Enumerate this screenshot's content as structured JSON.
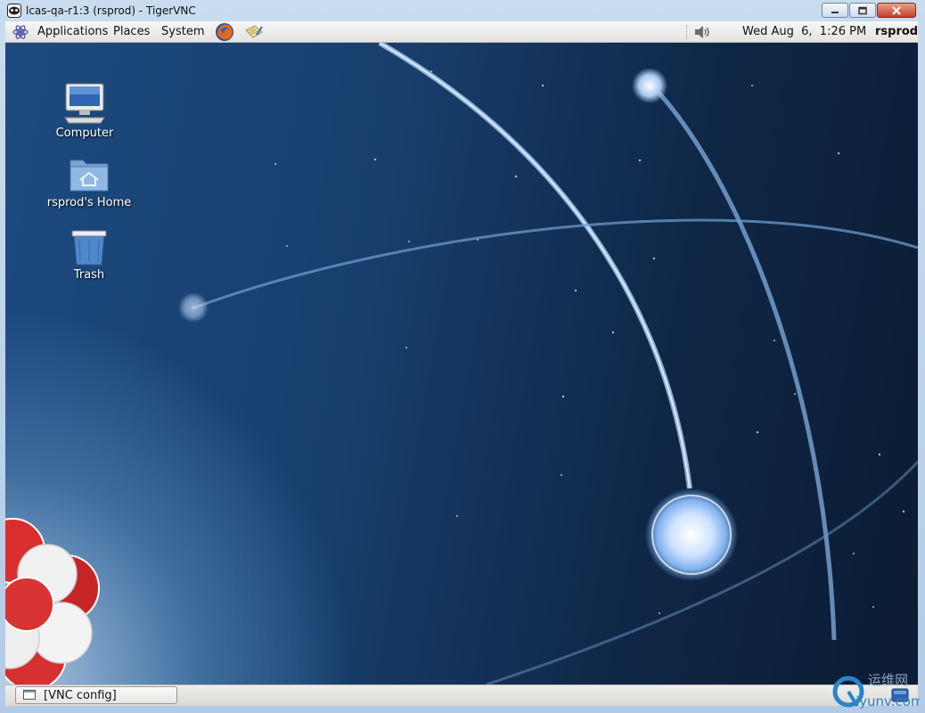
{
  "window": {
    "title": "lcas-qa-r1:3 (rsprod) - TigerVNC",
    "icon": "tigervnc-icon",
    "controls": [
      "minimize-icon",
      "maximize-icon",
      "close-icon"
    ]
  },
  "top_panel": {
    "menus": [
      "Applications",
      "Places",
      "System"
    ],
    "launchers": [
      "firefox-icon",
      "text-editor-icon"
    ],
    "tray": [
      "volume-icon"
    ],
    "clock": "Wed Aug  6,  1:26 PM",
    "user": "rsprod"
  },
  "desktop": {
    "icons": [
      {
        "label": "Computer",
        "icon": "computer-icon"
      },
      {
        "label": "rsprod's Home",
        "icon": "home-folder-icon"
      },
      {
        "label": "Trash",
        "icon": "trash-icon"
      }
    ]
  },
  "bottom_panel": {
    "tasks": [
      {
        "label": "[VNC config]",
        "icon": "window-icon"
      }
    ],
    "show_desktop": "show-desktop-icon"
  },
  "watermark": {
    "text_top": "运维网",
    "text_bottom": "iyunv.com"
  },
  "colors": {
    "accent": "#1d4a80",
    "panel": "#e4e3e1",
    "titlebar": "#c9dcf0"
  }
}
